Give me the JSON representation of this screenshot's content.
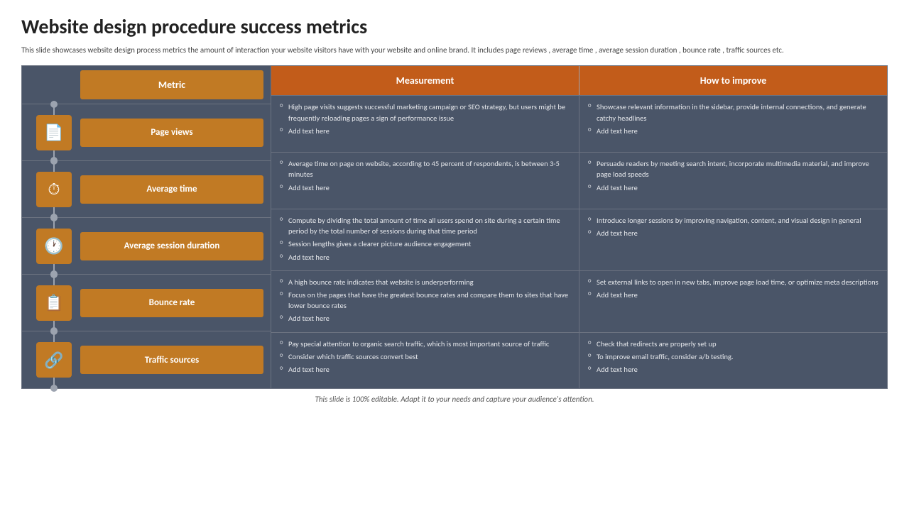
{
  "title": "Website design procedure success metrics",
  "subtitle": "This slide showcases website design process metrics  the amount of interaction your website visitors have with your website and online brand. It includes page reviews , average time , average session duration , bounce rate , traffic sources etc.",
  "header": {
    "metric_label": "Metric",
    "measurement_label": "Measurement",
    "how_label": "How to improve"
  },
  "metrics": [
    {
      "id": "page-views",
      "icon": "📄",
      "label": "Page views",
      "measurement": [
        "High page visits  suggests successful marketing campaign or SEO strategy, but users might be frequently reloading  pages  a sign of performance issue",
        "Add text here"
      ],
      "how_to_improve": [
        "Showcase relevant information in the sidebar, provide  internal connections, and generate catchy headlines",
        "Add text here"
      ]
    },
    {
      "id": "average-time",
      "icon": "⏱",
      "label": "Average time",
      "measurement": [
        "Average time on page on website, according to 45 percent of respondents, is between 3-5 minutes",
        "Add text here"
      ],
      "how_to_improve": [
        "Persuade readers by meeting search intent, incorporate multimedia material, and improve page load speeds",
        "Add text here"
      ]
    },
    {
      "id": "average-session-duration",
      "icon": "🕐",
      "label": "Average session duration",
      "measurement": [
        "Compute by dividing the total amount of time all users spend on  site during a certain time period by the total number of sessions during that time period",
        "Session lengths  gives a clearer picture  audience engagement",
        "Add text here"
      ],
      "how_to_improve": [
        "Introduce longer sessions by improving navigation, content, and visual design in general",
        "Add text here"
      ]
    },
    {
      "id": "bounce-rate",
      "icon": "📋",
      "label": "Bounce rate",
      "measurement": [
        "A high bounce rate indicates that  website is underperforming",
        "Focus on the pages that have the greatest bounce rates and compare them to sites that have lower bounce rates",
        "Add text here"
      ],
      "how_to_improve": [
        "Set  external links to open in new tabs, improve  page load time, or optimize meta descriptions",
        "Add text here"
      ]
    },
    {
      "id": "traffic-sources",
      "icon": "🔗",
      "label": "Traffic  sources",
      "measurement": [
        "Pay special attention to organic search traffic, which is most important source of traffic",
        "Consider which traffic sources convert best",
        "Add text here"
      ],
      "how_to_improve": [
        "Check that  redirects are properly set up",
        "To improve email traffic, consider a/b testing.",
        "Add text here"
      ]
    }
  ],
  "footer": "This slide is 100% editable. Adapt it to your needs and capture your audience's attention."
}
